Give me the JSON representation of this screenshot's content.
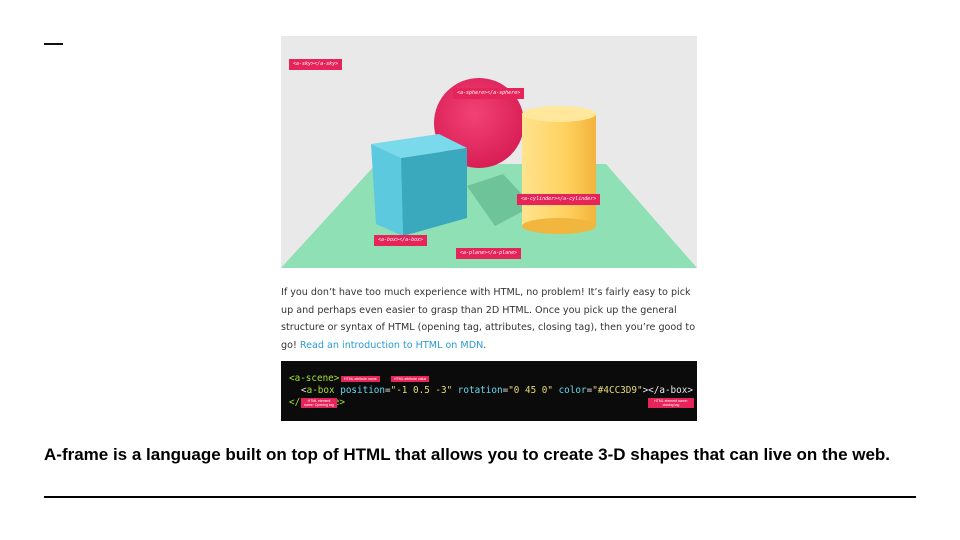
{
  "scene": {
    "tags": {
      "sky": "<a-sky></a-sky>",
      "sphere": "<a-sphere></a-sphere>",
      "cylinder": "<a-cylinder></a-cylinder>",
      "box": "<a-box></a-box>",
      "plane": "<a-plane></a-plane>"
    },
    "colors": {
      "sky": "#e9e9e9",
      "sphere": "#ec2a62",
      "cylinder": "#ffd56b",
      "box": "#4cc3d9",
      "plane": "#8fe0b4"
    }
  },
  "paragraph": {
    "text": "If you don’t have too much experience with HTML, no problem! It’s fairly easy to pick up and perhaps even easier to grasp than 2D HTML. Once you pick up the general structure or syntax of HTML (opening tag, attributes, closing tag), then you’re good to go! ",
    "link": "Read an introduction to HTML on MDN",
    "end": "."
  },
  "code": {
    "scene_open": "<a-scene>",
    "box_open_lt": "<",
    "box_tag": "a-box",
    "attr_position": "position",
    "eq": "=",
    "val_position": "\"-1 0.5 -3\"",
    "attr_rotation": "rotation",
    "val_rotation": "\"0 45 0\"",
    "attr_color": "color",
    "val_color": "\"#4CC3D9\"",
    "box_close": "></a-box>",
    "scene_close": "</a-scene>",
    "annotations": {
      "attr_name": "HTML attribute name",
      "attr_value": "HTML attribute value",
      "opening": "HTML element name: Opening tag",
      "closing": "HTML element name: closing tag"
    }
  },
  "caption": "A-frame is a language built on top of HTML that allows you to create 3-D shapes that can live on the web."
}
